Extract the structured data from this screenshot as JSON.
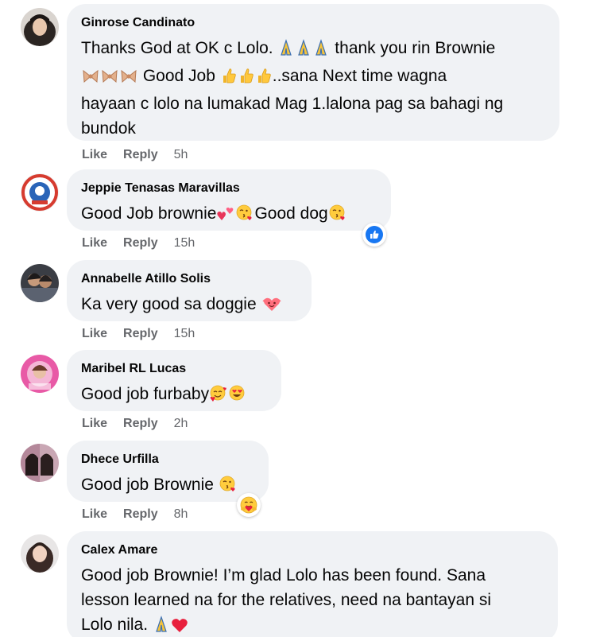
{
  "comments": [
    {
      "author": "Ginrose Candinato",
      "lines": [
        [
          "Thanks God at OK c Lolo. ",
          "pray",
          "pray",
          "pray",
          " thank you rin Brownie"
        ],
        [
          "bow",
          "bow",
          "bow",
          " Good Job ",
          "thumb",
          "thumb",
          "thumb",
          "..sana Next time wagna"
        ],
        [
          "hayaan c lolo na lumakad Mag 1.lalona pag sa bahagi ng"
        ],
        [
          "bundok"
        ]
      ],
      "like": "Like",
      "reply": "Reply",
      "time": "5h"
    },
    {
      "author": "Jeppie Tenasas Maravillas",
      "lines": [
        [
          "Good Job brownie",
          "hearts",
          "kiss",
          "Good dog",
          "kiss"
        ]
      ],
      "like": "Like",
      "reply": "Reply",
      "time": "15h",
      "reaction": "like-reaction-icon"
    },
    {
      "author": "Annabelle Atillo Solis",
      "lines": [
        [
          "Ka very good sa doggie ",
          "heartface"
        ]
      ],
      "like": "Like",
      "reply": "Reply",
      "time": "15h"
    },
    {
      "author": "Maribel RL Lucas",
      "lines": [
        [
          "Good job furbaby",
          "loveface",
          "hearteyes"
        ]
      ],
      "like": "Like",
      "reply": "Reply",
      "time": "2h"
    },
    {
      "author": "Dhece Urfilla",
      "lines": [
        [
          "Good job Brownie ",
          "kiss"
        ]
      ],
      "like": "Like",
      "reply": "Reply",
      "time": "8h",
      "reaction": "hug-reaction-icon"
    },
    {
      "author": "Calex Amare",
      "lines": [
        [
          "Good job Brownie! I’m glad Lolo has been found. Sana"
        ],
        [
          "lesson learned na for the relatives, need na bantayan si"
        ],
        [
          "Lolo nila. ",
          "pray",
          "redheart"
        ]
      ]
    }
  ],
  "colors": {
    "bubble": "#f0f2f5",
    "meta": "#65676b",
    "like_blue": "#1877f2"
  }
}
